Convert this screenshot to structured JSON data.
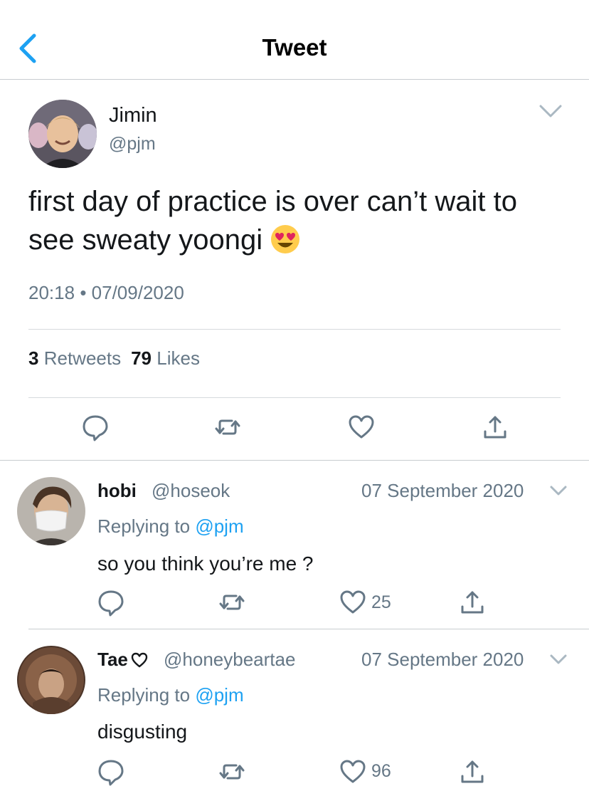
{
  "nav": {
    "title": "Tweet",
    "back_icon": "chevron-left-icon",
    "accent": "#1da1f2"
  },
  "tweet": {
    "name": "Jimin",
    "handle": "@pjm",
    "text": "first day of practice is over can’t wait to see sweaty yoongi",
    "emoji": "heart-eyes-emoji",
    "time": "20:18",
    "dot": "•",
    "date": "07/09/2020",
    "retweets_count": "3",
    "retweets_label": "Retweets",
    "likes_count": "79",
    "likes_label": "Likes",
    "actions": [
      "reply-icon",
      "retweet-icon",
      "like-icon",
      "share-icon"
    ]
  },
  "replies": [
    {
      "name": "hobi",
      "handle": "@hoseok",
      "date": "07 September 2020",
      "replying_prefix": "Replying to",
      "replying_to": "@pjm",
      "text": "so you think you’re me ?",
      "likes": "25"
    },
    {
      "name": "Tae",
      "name_icon": "heart-outline-icon",
      "handle": "@honeybeartae",
      "date": "07 September 2020",
      "replying_prefix": "Replying to",
      "replying_to": "@pjm",
      "text": "disgusting",
      "likes": "96"
    }
  ],
  "colors": {
    "text": "#14171a",
    "muted": "#657786",
    "link": "#1da1f2",
    "divider": "#c8ccd0"
  }
}
